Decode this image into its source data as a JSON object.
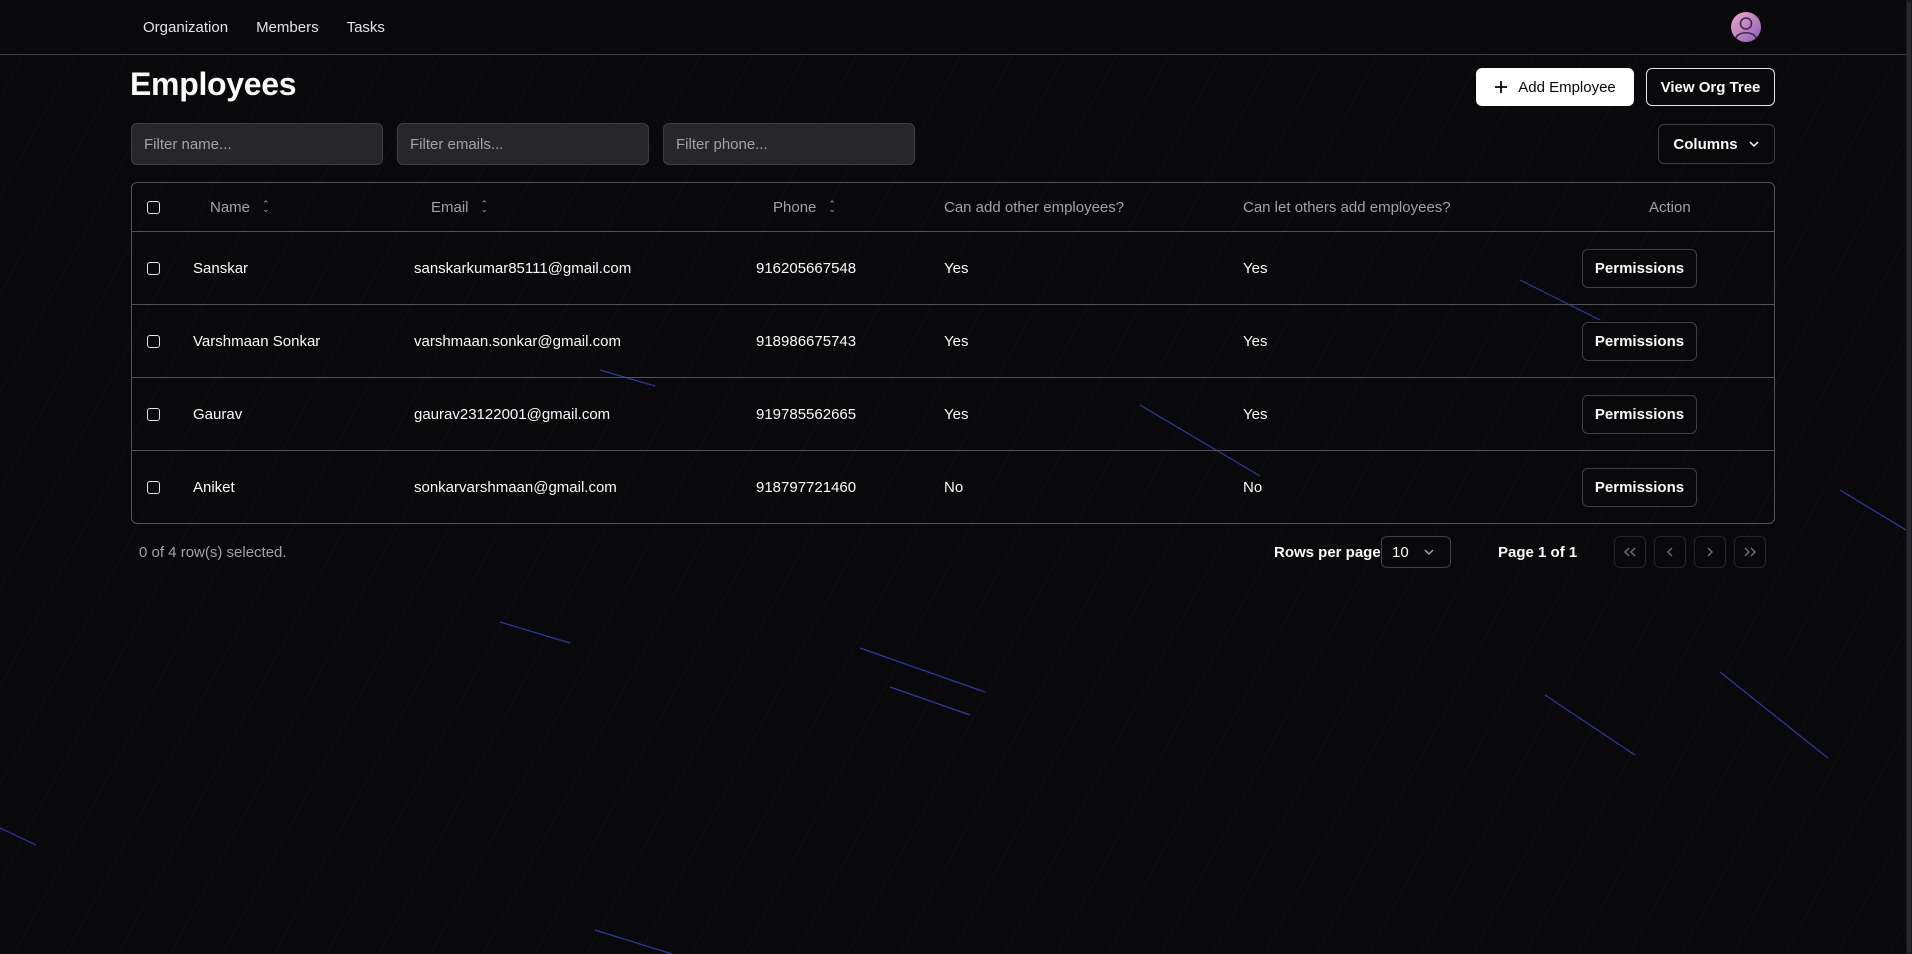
{
  "nav": {
    "links": [
      "Organization",
      "Members",
      "Tasks"
    ],
    "avatar_icon": "user-avatar-icon"
  },
  "page": {
    "title": "Employees",
    "add_button": "Add Employee",
    "org_tree_button": "View Org Tree"
  },
  "filters": {
    "name_placeholder": "Filter name...",
    "email_placeholder": "Filter emails...",
    "phone_placeholder": "Filter phone...",
    "name_value": "",
    "email_value": "",
    "phone_value": ""
  },
  "columns_button": "Columns",
  "table": {
    "headers": {
      "name": "Name",
      "email": "Email",
      "phone": "Phone",
      "can_add": "Can add other employees?",
      "can_let": "Can let others add employees?",
      "action": "Action"
    },
    "rows": [
      {
        "name": "Sanskar",
        "email": "sanskarkumar85111@gmail.com",
        "phone": "916205667548",
        "can_add": "Yes",
        "can_let": "Yes",
        "action": "Permissions"
      },
      {
        "name": "Varshmaan Sonkar",
        "email": "varshmaan.sonkar@gmail.com",
        "phone": "918986675743",
        "can_add": "Yes",
        "can_let": "Yes",
        "action": "Permissions"
      },
      {
        "name": "Gaurav",
        "email": "gaurav23122001@gmail.com",
        "phone": "919785562665",
        "can_add": "Yes",
        "can_let": "Yes",
        "action": "Permissions"
      },
      {
        "name": "Aniket",
        "email": "sonkarvarshmaan@gmail.com",
        "phone": "918797721460",
        "can_add": "No",
        "can_let": "No",
        "action": "Permissions"
      }
    ]
  },
  "footer": {
    "selection": "0 of 4 row(s) selected.",
    "rows_per_page_label": "Rows per page",
    "rows_per_page_value": "10",
    "page_label": "Page 1 of 1"
  },
  "colors": {
    "background": "#09090b",
    "border": "#3f3f46",
    "text": "#fafafa",
    "muted": "#a1a1aa",
    "streak": "#3b4fd8"
  }
}
